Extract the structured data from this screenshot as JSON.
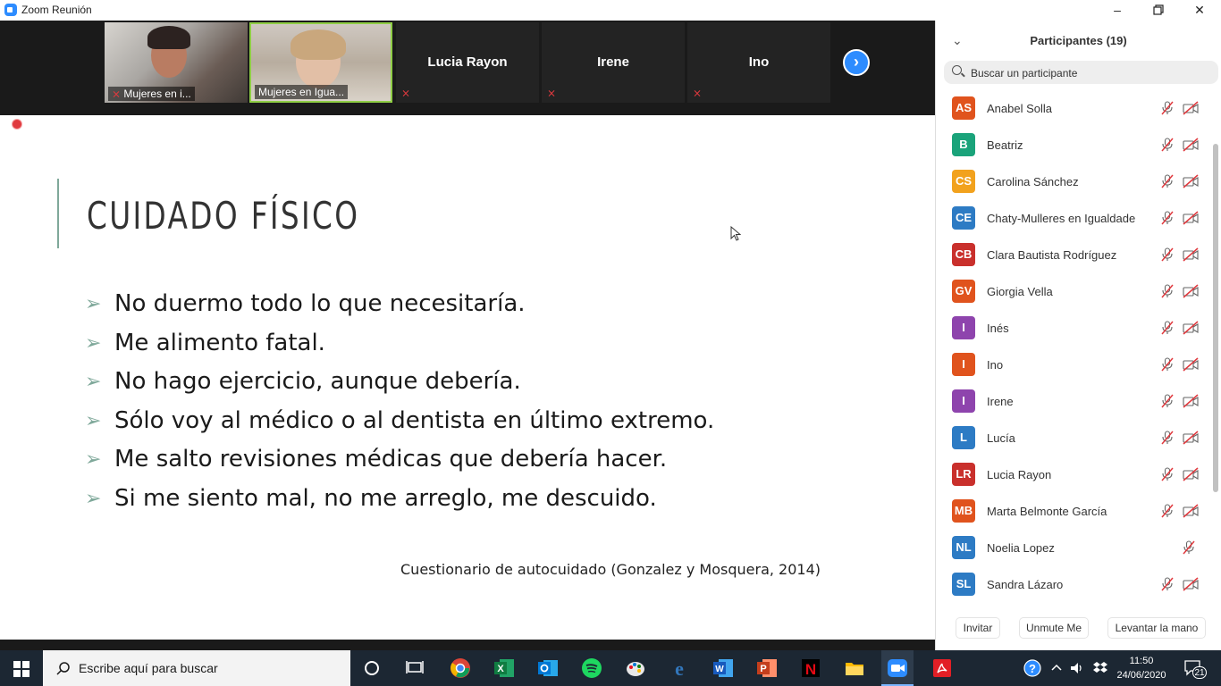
{
  "window": {
    "title": "Zoom Reunión"
  },
  "video_strip": {
    "tiles": [
      {
        "type": "video",
        "caption": "Mujeres en i..."
      },
      {
        "type": "video",
        "caption": "Mujeres en Igua..."
      },
      {
        "type": "name",
        "name": "Lucia Rayon"
      },
      {
        "type": "name",
        "name": "Irene"
      },
      {
        "type": "name",
        "name": "Ino"
      }
    ]
  },
  "slide": {
    "title": "CUIDADO FÍSICO",
    "bullets": [
      "No duermo todo lo que necesitaría.",
      "Me alimento fatal.",
      "No hago ejercicio, aunque debería.",
      "Sólo voy al médico o al dentista en último extremo.",
      "Me salto revisiones médicas que debería hacer.",
      "Si me siento mal, no me arreglo, me descuido."
    ],
    "citation": "Cuestionario de autocuidado (Gonzalez y Mosquera, 2014)",
    "accent_color": "#7fa89a"
  },
  "participants": {
    "title": "Participantes (19)",
    "search_placeholder": "Buscar un participante",
    "list": [
      {
        "initials": "AS",
        "name": "Anabel Solla",
        "color": "#e0531d",
        "mic_muted": true,
        "video_off": true
      },
      {
        "initials": "B",
        "name": "Beatriz",
        "color": "#1aa37a",
        "mic_muted": true,
        "video_off": true
      },
      {
        "initials": "CS",
        "name": "Carolina Sánchez",
        "color": "#f2a21d",
        "mic_muted": true,
        "video_off": true
      },
      {
        "initials": "CE",
        "name": "Chaty-Mulleres en Igualdade",
        "color": "#2d7bc4",
        "mic_muted": true,
        "video_off": true
      },
      {
        "initials": "CB",
        "name": "Clara Bautista Rodríguez",
        "color": "#c9302c",
        "mic_muted": true,
        "video_off": true
      },
      {
        "initials": "GV",
        "name": "Giorgia Vella",
        "color": "#e0531d",
        "mic_muted": true,
        "video_off": true
      },
      {
        "initials": "I",
        "name": "Inés",
        "color": "#8e44ad",
        "mic_muted": true,
        "video_off": true
      },
      {
        "initials": "I",
        "name": "Ino",
        "color": "#e0531d",
        "mic_muted": true,
        "video_off": true
      },
      {
        "initials": "I",
        "name": "Irene",
        "color": "#8e44ad",
        "mic_muted": true,
        "video_off": true
      },
      {
        "initials": "L",
        "name": "Lucía",
        "color": "#2d7bc4",
        "mic_muted": true,
        "video_off": true
      },
      {
        "initials": "LR",
        "name": "Lucia Rayon",
        "color": "#c9302c",
        "mic_muted": true,
        "video_off": true
      },
      {
        "initials": "MB",
        "name": "Marta Belmonte García",
        "color": "#e0531d",
        "mic_muted": true,
        "video_off": true
      },
      {
        "initials": "NL",
        "name": "Noelia Lopez",
        "color": "#2d7bc4",
        "mic_muted": true,
        "video_off": false
      },
      {
        "initials": "SL",
        "name": "Sandra Lázaro",
        "color": "#2d7bc4",
        "mic_muted": true,
        "video_off": true
      }
    ],
    "buttons": {
      "invite": "Invitar",
      "unmute": "Unmute Me",
      "raise_hand": "Levantar la mano"
    }
  },
  "taskbar": {
    "search_placeholder": "Escribe aquí para buscar",
    "time": "11:50",
    "date": "24/06/2020",
    "notifications": "21",
    "apps": [
      "cortana-icon",
      "task-view-icon",
      "chrome-icon",
      "excel-icon",
      "outlook-icon",
      "spotify-icon",
      "paint-icon",
      "edge-icon",
      "word-icon",
      "powerpoint-icon",
      "netflix-icon",
      "file-explorer-icon",
      "zoom-icon",
      "acrobat-icon"
    ]
  }
}
